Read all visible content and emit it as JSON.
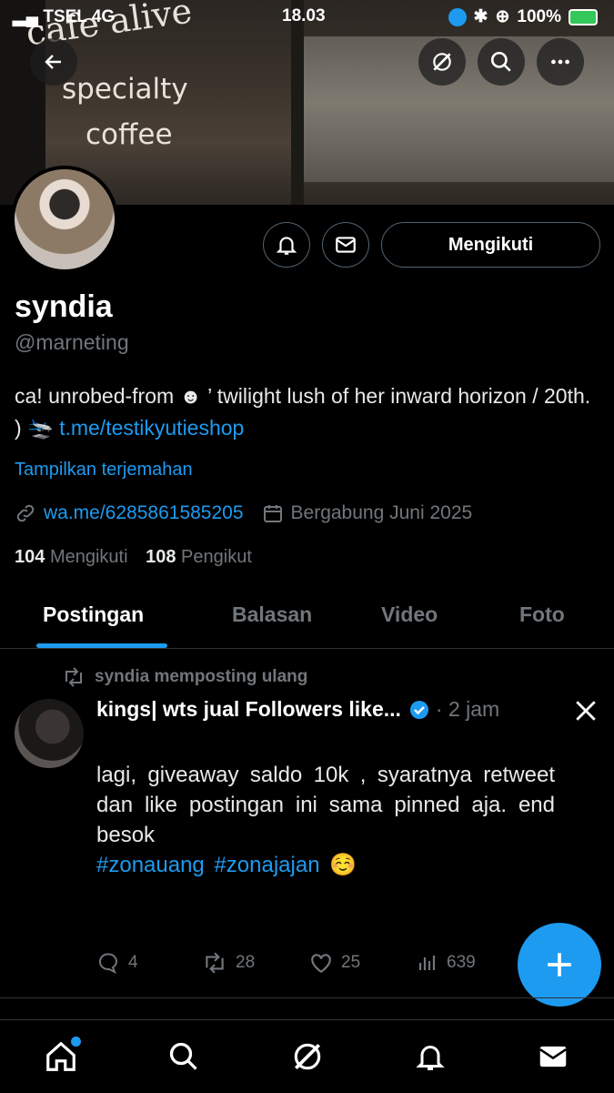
{
  "status": {
    "carrier": "TSEL",
    "network": "4G",
    "time": "18.03",
    "battery": "100%"
  },
  "banner": {
    "sign_line1": "cafe alive",
    "sign_line2": "specialty",
    "sign_line3": "coffee"
  },
  "profile": {
    "follow_button": "Mengikuti",
    "name": "syndia",
    "handle": "@marneting",
    "bio_text_1": "ca! unrobed-from ☻ ’ twilight lush of her inward horizon / 20th. ) 🛬 ",
    "bio_link": "t.me/testikyutieshop",
    "translate": "Tampilkan terjemahan",
    "website": "wa.me/6285861585205",
    "joined": "Bergabung Juni 2025",
    "following_count": "104",
    "following_label": "Mengikuti",
    "followers_count": "108",
    "followers_label": "Pengikut"
  },
  "tabs": [
    "Postingan",
    "Balasan",
    "Video",
    "Foto"
  ],
  "post": {
    "repost_label": "syndia memposting ulang",
    "author": "kings| wts jual Followers like...",
    "time": "· 2 jam",
    "text": "lagi, giveaway saldo 10k , syaratnya retweet dan like postingan ini sama pinned aja. end besok",
    "hashtags": "#zonauang #zonajajan ☺️",
    "replies": "4",
    "reposts": "28",
    "likes": "25",
    "views": "639"
  },
  "colors": {
    "accent": "#1d9bf0",
    "muted": "#71767b",
    "background": "#000000"
  },
  "icons": [
    "back-icon",
    "grok-icon",
    "search-icon",
    "more-icon",
    "notify-icon",
    "message-icon",
    "link-icon",
    "calendar-icon",
    "repost-icon",
    "verified-icon",
    "x-logo-icon",
    "reply-icon",
    "like-icon",
    "views-icon",
    "plus-icon",
    "home-icon",
    "notifications-icon",
    "mail-icon"
  ]
}
